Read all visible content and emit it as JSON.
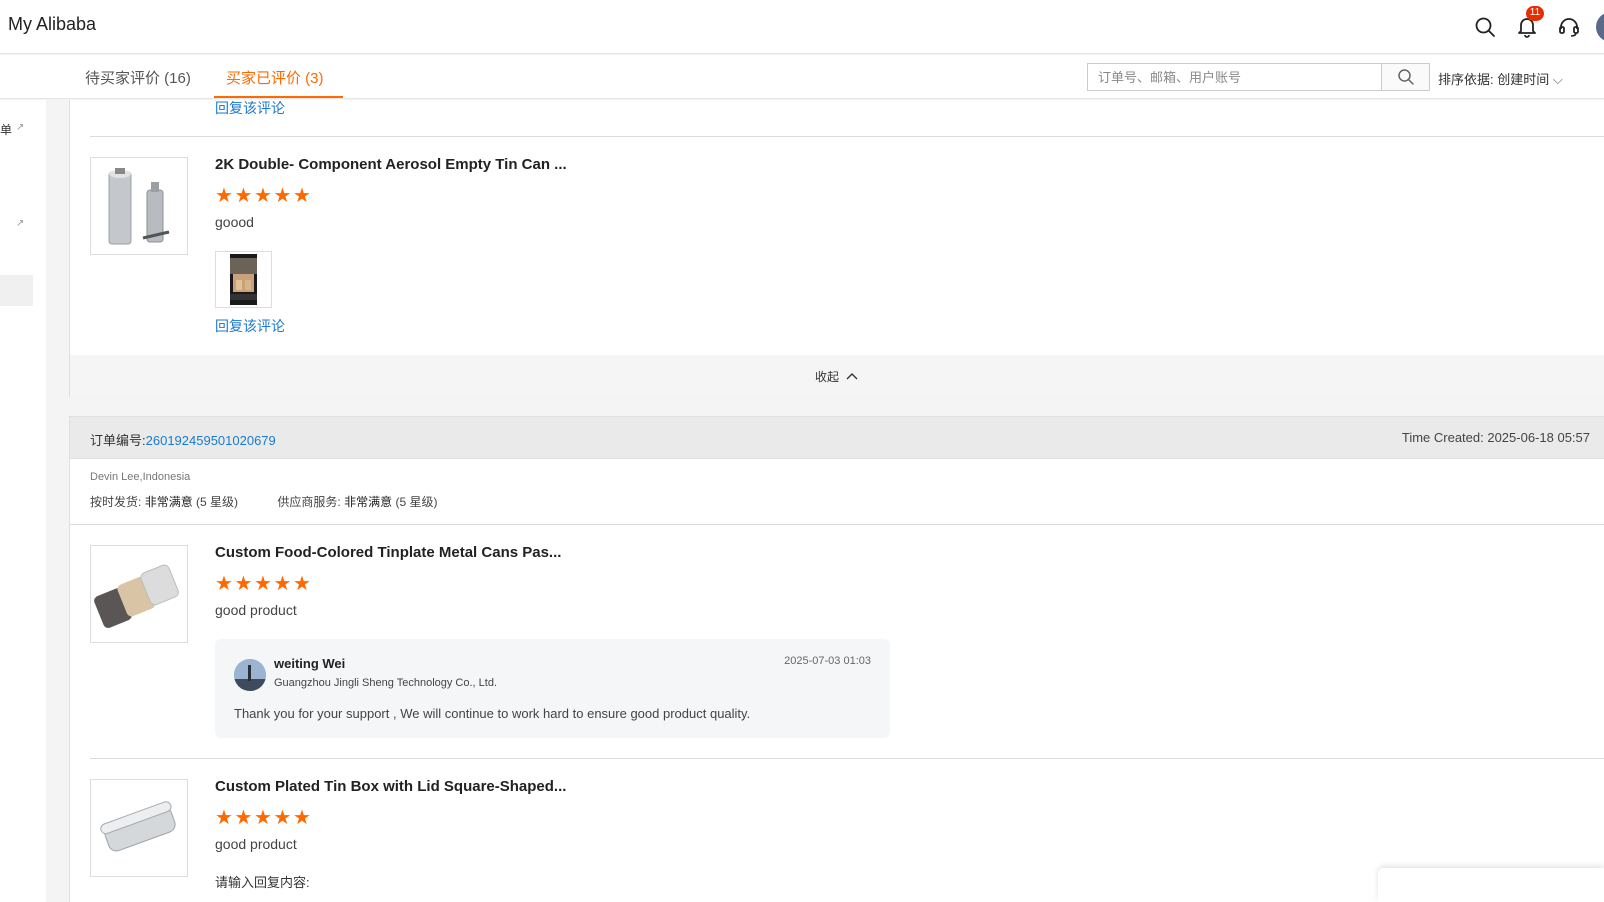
{
  "header": {
    "brand": "My Alibaba",
    "notification_count": "11"
  },
  "tabs": [
    {
      "label": "待买家评价 (16)"
    },
    {
      "label": "买家已评价 (3)"
    }
  ],
  "search": {
    "placeholder": "订单号、邮箱、用户账号"
  },
  "sort_label": "排序依据: 创建时间",
  "sidebar": {
    "item1": "单"
  },
  "review_a": {
    "reply_link_prev": "回复该评论",
    "product": {
      "title": "2K Double- Component Aerosol Empty Tin Can ...",
      "rating": 5,
      "comment": "goood",
      "reply_link": "回复该评论"
    },
    "collapse_label": "收起"
  },
  "order_b": {
    "order_label": "订单编号:",
    "order_number": "260192459501020679",
    "time_created": "Time Created: 2025-06-18 05:57",
    "buyer": "Devin Lee,Indonesia",
    "on_time_label": "按时发货:",
    "on_time_value": "非常满意",
    "on_time_stars": "(5 星级)",
    "service_label": "供应商服务:",
    "service_value": "非常满意",
    "service_stars": "(5 星级)",
    "product1": {
      "title": "Custom Food-Colored Tinplate Metal Cans Pas...",
      "rating": 5,
      "comment": "good product",
      "reply": {
        "name": "weiting Wei",
        "company": "Guangzhou Jingli Sheng Technology Co., Ltd.",
        "time": "2025-07-03 01:03",
        "text": "Thank you for your support , We will continue to work hard to ensure good product quality."
      }
    },
    "product2": {
      "title": "Custom Plated Tin Box with Lid Square-Shaped...",
      "rating": 5,
      "comment": "good product",
      "input_prompt": "请输入回复内容:"
    }
  },
  "colors": {
    "accent": "#ff6a00",
    "link": "#1a7bd1",
    "badge": "#e62e04"
  }
}
